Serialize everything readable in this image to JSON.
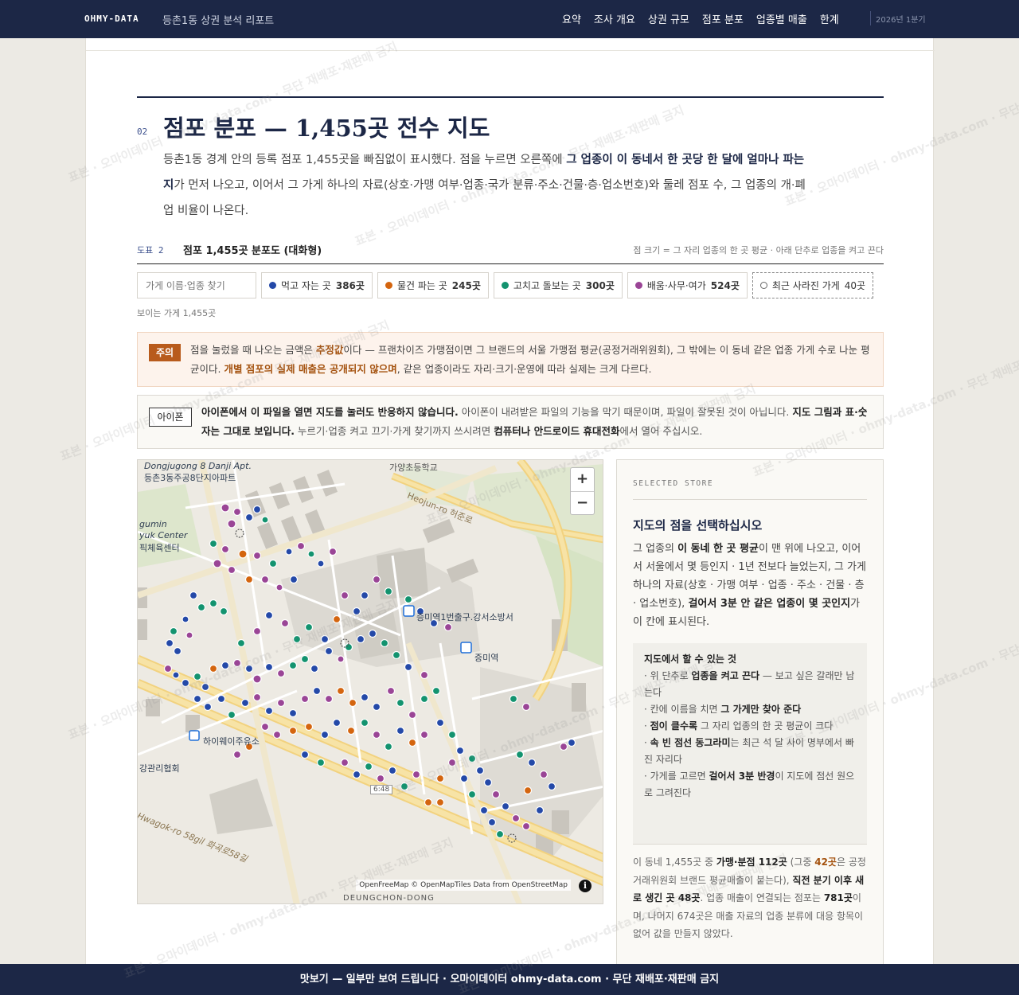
{
  "nav": {
    "brand": "OHMY-DATA",
    "doc_title": "등촌1동 상권 분석 리포트",
    "items": [
      "요약",
      "조사 개요",
      "상권 규모",
      "점포 분포",
      "업종별 매출",
      "한계"
    ],
    "period": "2026년 1분기"
  },
  "section": {
    "number": "02",
    "title": "점포 분포 — 1,455곳 전수 지도",
    "lead_1": "등촌1동 경계 안의 등록 점포 1,455곳을 빠짐없이 표시했다. 점을 누르면 오른쪽에 ",
    "lead_bold_1": "그 업종이 이 동네서 한 곳당 한 달에 얼마나 파는지",
    "lead_2": "가 먼저 나오고, 이어서 그 가게 하나의 자료(상호·가맹 여부·업종·국가 분류·주소·건물·층·업소번호)와 둘레 점포 수, 그 업종의 개·폐업 비율이 나온다."
  },
  "figure": {
    "number": "도표 2",
    "title": "점포 1,455곳 분포도 (대화형)",
    "note": "점 크기 = 그 자리 업종의 한 곳 평균 · 아래 단추로 업종을 켜고 끈다"
  },
  "filters": {
    "search_placeholder": "가게 이름·업종 찾기",
    "chips": [
      {
        "label": "먹고 자는 곳",
        "count": "386곳",
        "color": "#2449a8"
      },
      {
        "label": "물건 파는 곳",
        "count": "245곳",
        "color": "#d4650f"
      },
      {
        "label": "고치고 돌보는 곳",
        "count": "300곳",
        "color": "#13936f"
      },
      {
        "label": "배움·사무·여가",
        "count": "524곳",
        "color": "#9a4596"
      }
    ],
    "closed_chip": {
      "label": "최근 사라진 가게",
      "count": "40곳"
    },
    "visible_count": "보이는 가게 1,455곳"
  },
  "warning": {
    "tag": "주의",
    "t1": "점을 눌렀을 때 나오는 금액은 ",
    "b1": "추정값",
    "t2": "이다 — 프랜차이즈 가맹점이면 그 브랜드의 서울 가맹점 평균(공정거래위원회), 그 밖에는 이 동네 같은 업종 가게 수로 나눈 평균이다. ",
    "b2": "개별 점포의 실제 매출은 공개되지 않으며",
    "t3": ", 같은 업종이라도 자리·크기·운영에 따라 실제는 크게 다르다."
  },
  "iphone": {
    "tag": "아이폰",
    "b1": "아이폰에서 이 파일을 열면 지도를 눌러도 반응하지 않습니다.",
    "t1": " 아이폰이 내려받은 파일의 기능을 막기 때문이며, 파일이 잘못된 것이 아닙니다. ",
    "b2": "지도 그림과 표·숫자는 그대로 보입니다.",
    "t2": " 누르기·업종 켜고 끄기·가게 찾기까지 쓰시려면 ",
    "b3": "컴퓨터나 안드로이드 휴대전화",
    "t3": "에서 열어 주십시오."
  },
  "map": {
    "zoom_in": "+",
    "zoom_out": "−",
    "attribution": "OpenFreeMap © OpenMapTiles Data from OpenStreetMap",
    "info": "i",
    "labels": {
      "apt_en": "Dongjugong 8 Danji Apt.",
      "apt_ko": "등촌3동주공8단지아파트",
      "school": "가양초등학교",
      "heojun": "Heojun-ro 허준로",
      "gym_en1": "gumin",
      "gym_en2": "yuk Center",
      "gym_ko": "픽체육센터",
      "exit": "증미역1번출구.강서소방서",
      "station": "증미역",
      "gas": "하이웨이주유소",
      "gangnam": "강관리협회",
      "route": "6:48",
      "hwagok": "Hwagok-ro 58gil 화곡로58길",
      "district": "DEUNGCHON-DONG"
    }
  },
  "side": {
    "eyebrow": "SELECTED STORE",
    "title": "지도의 점을 선택하십시오",
    "d1": "그 업종의 ",
    "b1": "이 동네 한 곳 평균",
    "d2": "이 맨 위에 나오고, 이어서 서울에서 몇 등인지 · 1년 전보다 늘었는지, 그 가게 하나의 자료(상호 · 가맹 여부 · 업종 · 주소 · 건물 · 층 · 업소번호), ",
    "b2": "걸어서 3분 안 같은 업종이 몇 곳인지",
    "d3": "가 이 칸에 표시된다.",
    "howto_title": "지도에서 할 수 있는 것",
    "h1a": "· 위 단추로 ",
    "h1b": "업종을 켜고 끈다",
    "h1c": " — 보고 싶은 갈래만 남는다",
    "h2a": "· 칸에 이름을 치면 ",
    "h2b": "그 가게만 찾아 준다",
    "h3a": "· ",
    "h3b": "점이 클수록",
    "h3c": " 그 자리 업종의 한 곳 평균이 크다",
    "h4a": "· ",
    "h4b": "속 빈 점선 동그라미",
    "h4c": "는 최근 석 달 사이 명부에서 빠진 자리다",
    "h5a": "· 가게를 고르면 ",
    "h5b": "걸어서 3분 반경",
    "h5c": "이 지도에 점선 원으로 그려진다",
    "f1": "이 동네 1,455곳 중 ",
    "fb1": "가맹·분점 112곳",
    "f2": " (그중 ",
    "fo1": "42곳",
    "f3": "은 공정거래위원회 브랜드 평균매출이 붙는다), ",
    "fb2": "직전 분기 이후 새로 생긴 곳 48곳",
    "f4": ". 업종 매출이 연결되는 점포는 ",
    "fb3": "781곳",
    "f5": "이며, 나머지 674곳은 매출 자료의 업종 분류에 대응 항목이 없어 값을 만들지 않았다."
  },
  "footer": {
    "text": "맛보기 — 일부만 보여 드립니다 · 오마이데이터 ohmy-data.com · 무단 재배포·재판매 금지"
  },
  "watermark": {
    "text": "표본 · 오마이데이터 · ohmy-data.com · 무단 재배포·재판매 금지"
  }
}
